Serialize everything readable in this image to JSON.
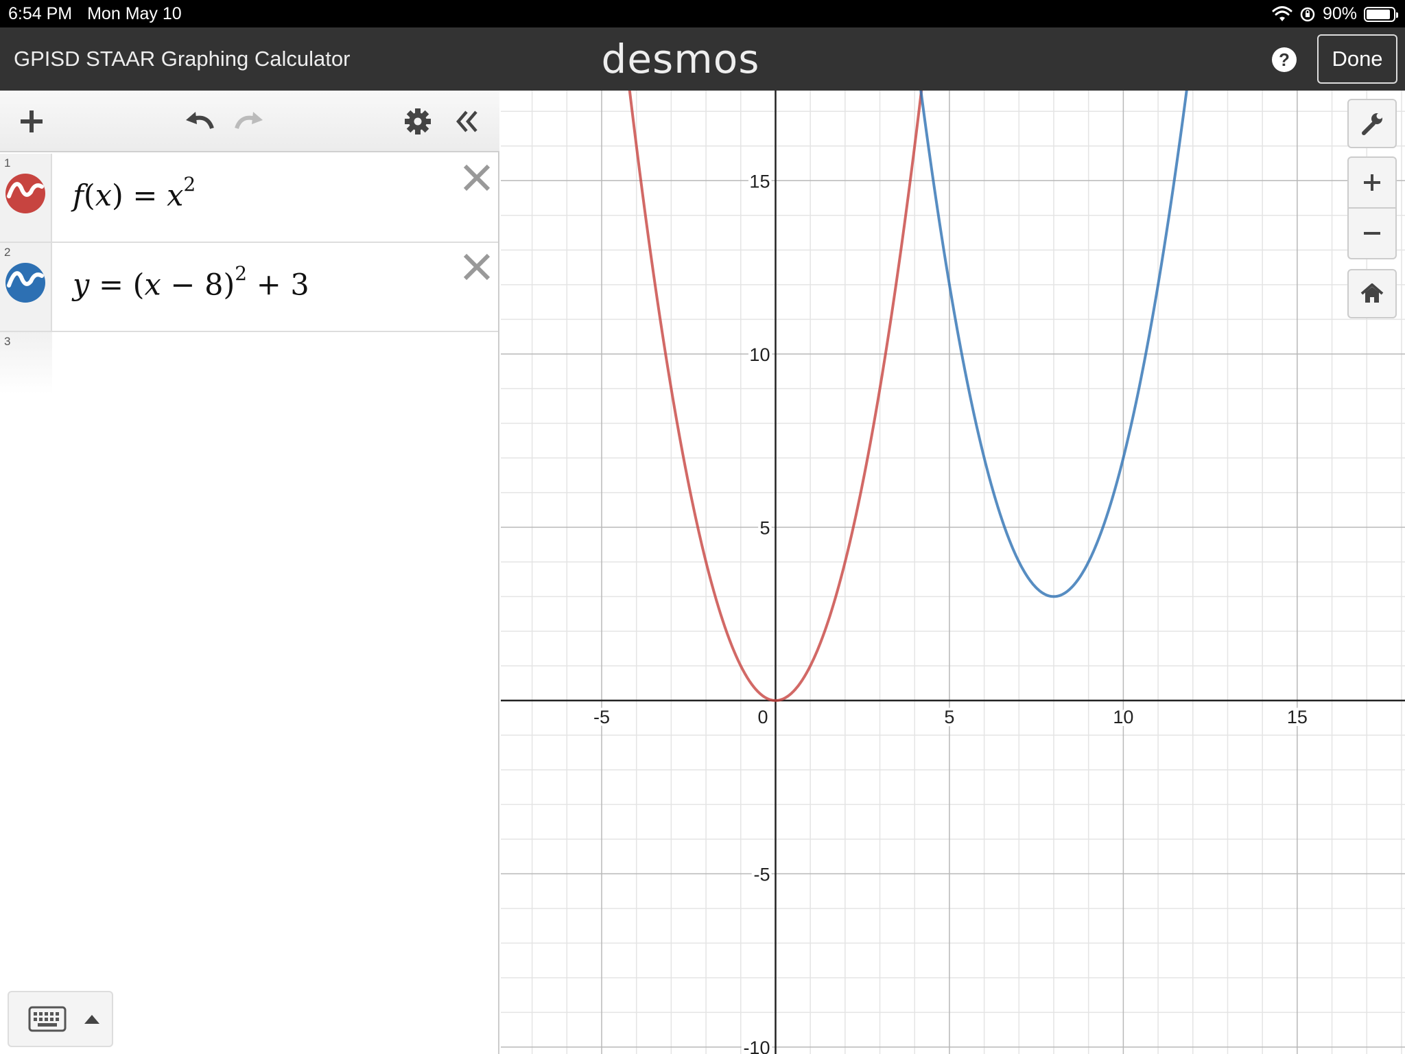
{
  "status_bar": {
    "time": "6:54 PM",
    "date": "Mon May 10",
    "battery": "90%",
    "battery_level": 0.9
  },
  "app_bar": {
    "title": "GPISD STAAR Graphing Calculator",
    "logo": "desmos",
    "help_label": "?",
    "done_label": "Done"
  },
  "toolbar": {
    "icons": [
      "plus-icon",
      "undo-icon",
      "redo-icon",
      "gear-icon",
      "collapse-chevrons-icon"
    ]
  },
  "expressions": [
    {
      "number": "1",
      "color": "#c74440",
      "parts": [
        "f",
        "(",
        "x",
        ")",
        " = ",
        "x"
      ],
      "exponent": "2",
      "tail": ""
    },
    {
      "number": "2",
      "color": "#2d70b3",
      "parts": [
        "y",
        " = ",
        "(",
        "x",
        " − 8",
        ")"
      ],
      "exponent": "2",
      "tail": " + 3"
    },
    {
      "number": "3"
    }
  ],
  "graph": {
    "x_ticks": [
      "-5",
      "0",
      "5",
      "10",
      "15"
    ],
    "y_ticks": [
      "15",
      "10",
      "5",
      "-5",
      "-10"
    ],
    "xlim": [
      -7.9,
      18.1
    ],
    "ylim": [
      -10.2,
      17.6
    ],
    "grid": true,
    "minor_step": 1,
    "major_step": 5
  },
  "chart_data": {
    "type": "line",
    "xlim": [
      -7.9,
      18.1
    ],
    "ylim": [
      -10.2,
      17.6
    ],
    "grid": true,
    "series": [
      {
        "name": "f(x) = x^2",
        "color": "#c74440",
        "expression": "x^2",
        "x": [
          -4.2,
          -3,
          -2,
          -1,
          0,
          1,
          2,
          3,
          4.2
        ],
        "y": [
          17.64,
          9,
          4,
          1,
          0,
          1,
          4,
          9,
          17.64
        ]
      },
      {
        "name": "y = (x − 8)^2 + 3",
        "color": "#2d70b3",
        "expression": "(x-8)^2+3",
        "x": [
          4.2,
          5,
          6,
          7,
          8,
          9,
          10,
          11,
          11.8
        ],
        "y": [
          17.44,
          12,
          7,
          4,
          3,
          4,
          7,
          12,
          17.44
        ]
      }
    ]
  },
  "controls": [
    "wrench-icon",
    "zoom-in-icon",
    "zoom-out-icon",
    "home-icon"
  ]
}
